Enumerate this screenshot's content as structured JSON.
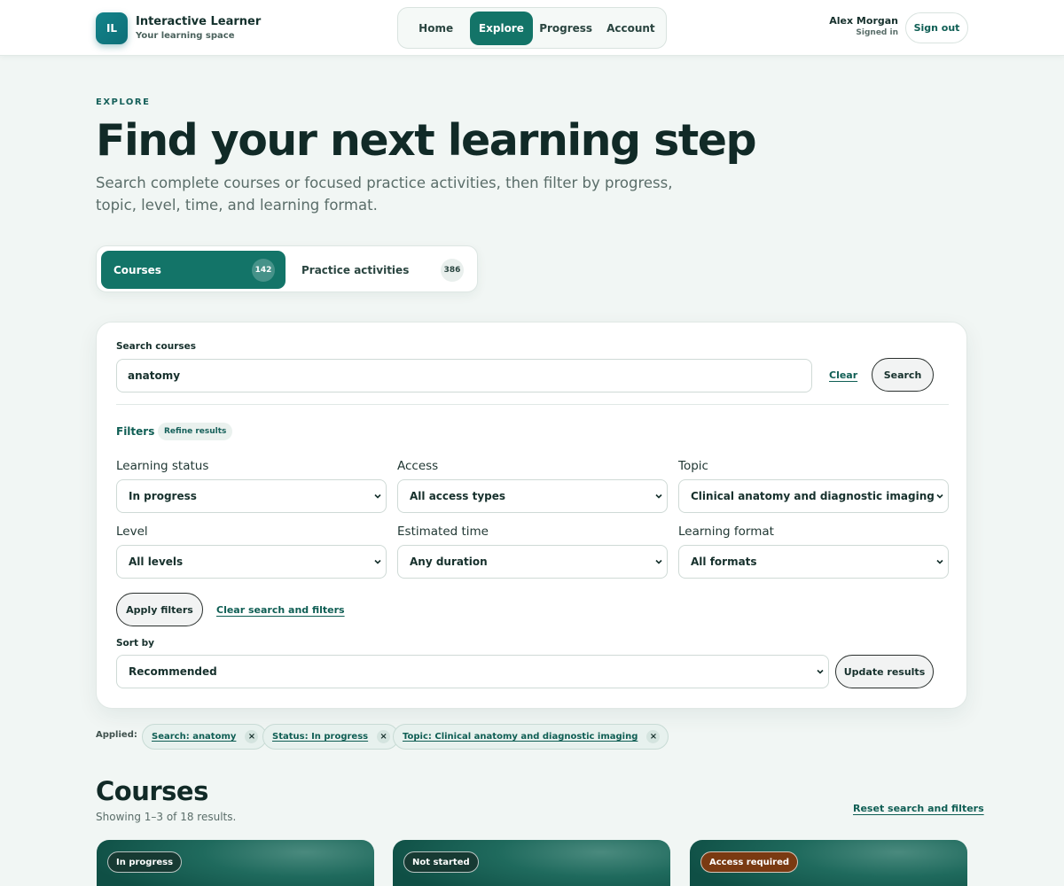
{
  "header": {
    "logo_initials": "IL",
    "brand_name": "Interactive Learner",
    "brand_tagline": "Your learning space",
    "nav": [
      {
        "label": "Home"
      },
      {
        "label": "Explore"
      },
      {
        "label": "Progress"
      },
      {
        "label": "Account"
      }
    ],
    "active_nav": "Explore",
    "user_name": "Alex Morgan",
    "user_status": "Signed in",
    "signout_label": "Sign out"
  },
  "hero": {
    "eyebrow": "EXPLORE",
    "title": "Find your next learning step",
    "subtitle": "Search complete courses or focused practice activities, then filter by progress, topic, level, time, and learning format."
  },
  "tabs": [
    {
      "label": "Courses",
      "count": "142",
      "active": true
    },
    {
      "label": "Practice activities",
      "count": "386",
      "active": false
    }
  ],
  "search": {
    "label": "Search courses",
    "value": "anatomy",
    "clear_label": "Clear",
    "search_label": "Search"
  },
  "filters": {
    "title": "Filters",
    "badge": "Refine results",
    "fields": [
      {
        "label": "Learning status",
        "value": "In progress"
      },
      {
        "label": "Access",
        "value": "All access types"
      },
      {
        "label": "Topic",
        "value": "Clinical anatomy and diagnostic imaging"
      },
      {
        "label": "Level",
        "value": "All levels"
      },
      {
        "label": "Estimated time",
        "value": "Any duration"
      },
      {
        "label": "Learning format",
        "value": "All formats"
      }
    ],
    "apply_label": "Apply filters",
    "clear_all_label": "Clear search and filters",
    "sort_label": "Sort by",
    "sort_value": "Recommended",
    "update_label": "Update results"
  },
  "applied": {
    "label": "Applied:",
    "chips": [
      {
        "text": "Search: anatomy"
      },
      {
        "text": "Status: In progress"
      },
      {
        "text": "Topic: Clinical anatomy and diagnostic imaging"
      }
    ],
    "remove_glyph": "×"
  },
  "results": {
    "title": "Courses",
    "count_text": "Showing 1–3 of 18 results.",
    "reset_label": "Reset search and filters",
    "cards": [
      {
        "status": "In progress",
        "badge_color": "#173a33"
      },
      {
        "status": "Not started",
        "badge_color": "#173a33"
      },
      {
        "status": "Access required",
        "badge_color": "#7a3a12"
      }
    ]
  },
  "colors": {
    "accent": "#137468",
    "page_background": "#f1f6f4",
    "link": "#0f5e54"
  },
  "icons": [
    "chevron-down-icon",
    "close-icon"
  ]
}
